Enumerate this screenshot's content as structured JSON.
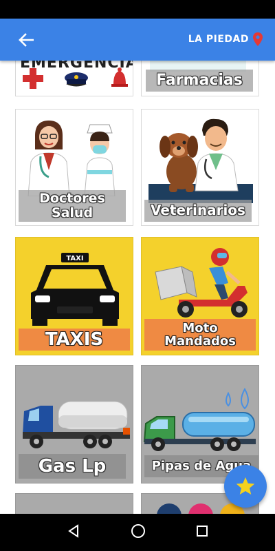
{
  "appbar": {
    "location_label": "LA PIEDAD"
  },
  "tiles": {
    "emergencias": {
      "label": "EMERGENCIAS"
    },
    "farmacias": {
      "label": "Farmacias"
    },
    "doctores": {
      "label_line1": "Doctores",
      "label_line2": "Salud"
    },
    "veterinarios": {
      "label": "Veterinarios"
    },
    "taxis": {
      "label": "TAXIS",
      "sign": "TAXI"
    },
    "moto": {
      "label_line1": "Moto",
      "label_line2": "Mandados"
    },
    "gas": {
      "label": "Gas Lp"
    },
    "pipas": {
      "label": "Pipas de Agua"
    }
  },
  "colors": {
    "appbar": "#3b82e6",
    "yellow_tile": "#f4d12c",
    "gray_tile": "#aaaaaa",
    "orange_label": "#ef8a43",
    "fab_star": "#f6d21e",
    "location_pin": "#e53935"
  },
  "icons": {
    "back": "arrow-left-icon",
    "location": "location-pin-icon",
    "fab": "star-icon",
    "nav_back": "triangle-back-icon",
    "nav_home": "circle-home-icon",
    "nav_recents": "square-recents-icon"
  }
}
